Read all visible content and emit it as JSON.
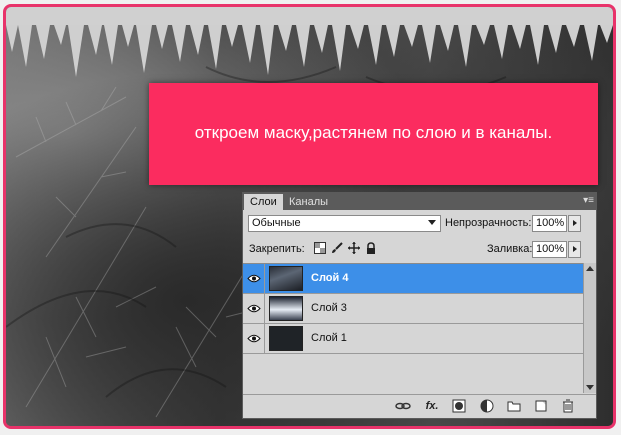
{
  "banner": {
    "text": "откроем маску,растянем по слою и в каналы."
  },
  "panel": {
    "tabs": [
      {
        "label": "Слои",
        "active": true
      },
      {
        "label": "Каналы",
        "active": false
      }
    ],
    "blend_mode": "Обычные",
    "opacity_label": "Непрозрачность:",
    "opacity_value": "100%",
    "lock_label": "Закрепить:",
    "fill_label": "Заливка:",
    "fill_value": "100%",
    "layers": [
      {
        "name": "Слой 4",
        "visible": true,
        "selected": true
      },
      {
        "name": "Слой 3",
        "visible": true,
        "selected": false
      },
      {
        "name": "Слой 1",
        "visible": true,
        "selected": false
      }
    ],
    "footer_icons": [
      "link-icon",
      "fx-icon",
      "mask-icon",
      "adjustment-icon",
      "folder-icon",
      "new-layer-icon",
      "trash-icon"
    ]
  },
  "colors": {
    "frame": "#e8336a",
    "banner": "#fb2c5f",
    "selection": "#3d8fe8"
  }
}
